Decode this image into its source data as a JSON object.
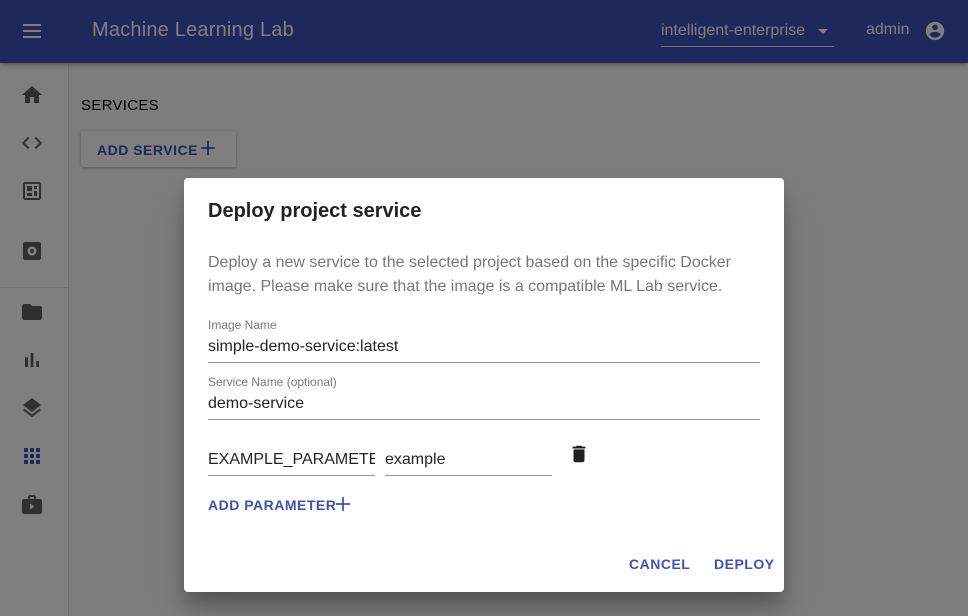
{
  "app": {
    "title": "Machine Learning Lab",
    "project": "intelligent-enterprise",
    "user": "admin",
    "colors": {
      "primary": "#3f51b5",
      "primary_text": "#ffffff"
    }
  },
  "sidebar": {
    "items": [
      {
        "icon": "home-icon"
      },
      {
        "icon": "code-icon"
      },
      {
        "icon": "dashboard-icon"
      },
      {
        "icon": "settings-icon"
      },
      {
        "icon": "folder-icon"
      },
      {
        "icon": "bar-chart-icon"
      },
      {
        "icon": "layers-icon"
      },
      {
        "icon": "apps-grid-icon",
        "active": true
      },
      {
        "icon": "briefcase-icon"
      }
    ]
  },
  "main": {
    "heading": "SERVICES",
    "add_service_label": "ADD SERVICE"
  },
  "dialog": {
    "title": "Deploy project service",
    "description": "Deploy a new service to the selected project based on the specific Docker image. Please make sure that the image is a compatible ML Lab service.",
    "image_name": {
      "label": "Image Name",
      "value": "simple-demo-service:latest"
    },
    "service_name": {
      "label": "Service Name (optional)",
      "value": "demo-service"
    },
    "parameter": {
      "key": "EXAMPLE_PARAMETER",
      "value": "example"
    },
    "add_parameter_label": "ADD PARAMETER",
    "cancel_label": "CANCEL",
    "deploy_label": "DEPLOY"
  }
}
